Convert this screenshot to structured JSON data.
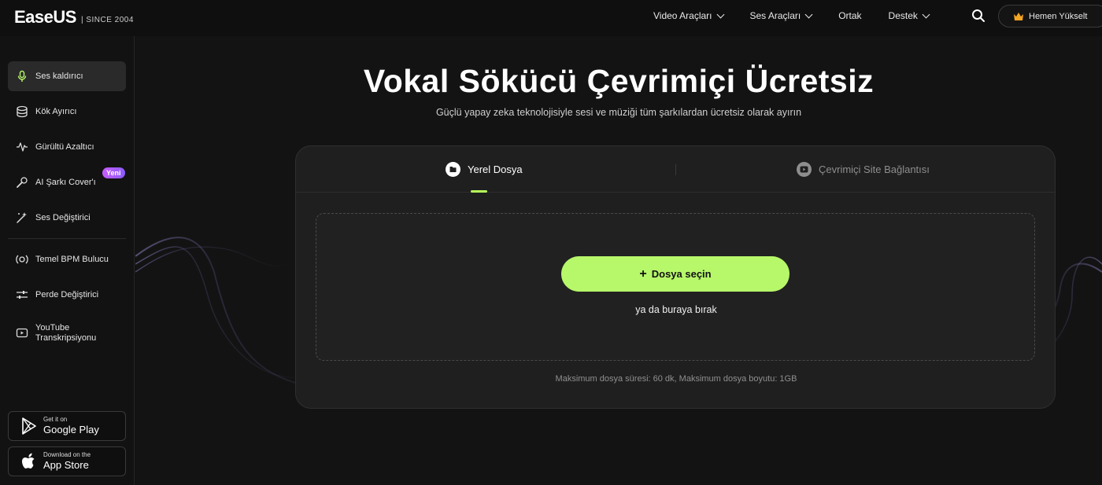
{
  "header": {
    "logo_text": "EaseUS",
    "logo_since": "| SINCE 2004",
    "nav": [
      {
        "label": "Video Araçları",
        "has_dropdown": true
      },
      {
        "label": "Ses Araçları",
        "has_dropdown": true
      },
      {
        "label": "Ortak",
        "has_dropdown": false
      },
      {
        "label": "Destek",
        "has_dropdown": true
      }
    ],
    "search_icon": "search-icon",
    "upgrade_label": "Hemen Yükselt",
    "upgrade_icon": "crown-icon"
  },
  "sidebar": {
    "items": [
      {
        "label": "Ses kaldırıcı",
        "icon": "microphone-icon",
        "active": true
      },
      {
        "label": "Kök Ayırıcı",
        "icon": "stack-icon"
      },
      {
        "label": "Gürültü Azaltıcı",
        "icon": "waveform-icon"
      },
      {
        "label": "AI Şarkı Cover'ı",
        "icon": "karaoke-mic-icon",
        "badge": "Yeni"
      },
      {
        "label": "Ses Değiştirici",
        "icon": "magic-wand-icon"
      },
      {
        "label": "Temel BPM Bulucu",
        "icon": "bpm-icon"
      },
      {
        "label": "Perde Değiştirici",
        "icon": "sliders-icon"
      },
      {
        "label": "YouTube Transkripsiyonu",
        "icon": "youtube-transcript-icon"
      }
    ],
    "stores": [
      {
        "small": "Get it on",
        "big": "Google Play",
        "icon": "google-play-icon"
      },
      {
        "small": "Download on the",
        "big": "App Store",
        "icon": "apple-icon"
      }
    ]
  },
  "main": {
    "title": "Vokal Sökücü Çevrimiçi Ücretsiz",
    "subtitle": "Güçlü yapay zeka teknolojisiyle sesi ve müziği tüm şarkılardan ücretsiz olarak ayırın",
    "tabs": [
      {
        "label": "Yerel Dosya",
        "icon": "file-icon",
        "active": true
      },
      {
        "label": "Çevrimiçi Site Bağlantısı",
        "icon": "play-circle-icon",
        "active": false
      }
    ],
    "choose_button": "Dosya seçin",
    "drop_hint": "ya da buraya bırak",
    "limits": "Maksimum dosya süresi: 60 dk, Maksimum dosya boyutu: 1GB"
  },
  "colors": {
    "accent": "#b7f76a",
    "background": "#121212",
    "card": "#1f1f1f",
    "badge": "#a35cff"
  }
}
